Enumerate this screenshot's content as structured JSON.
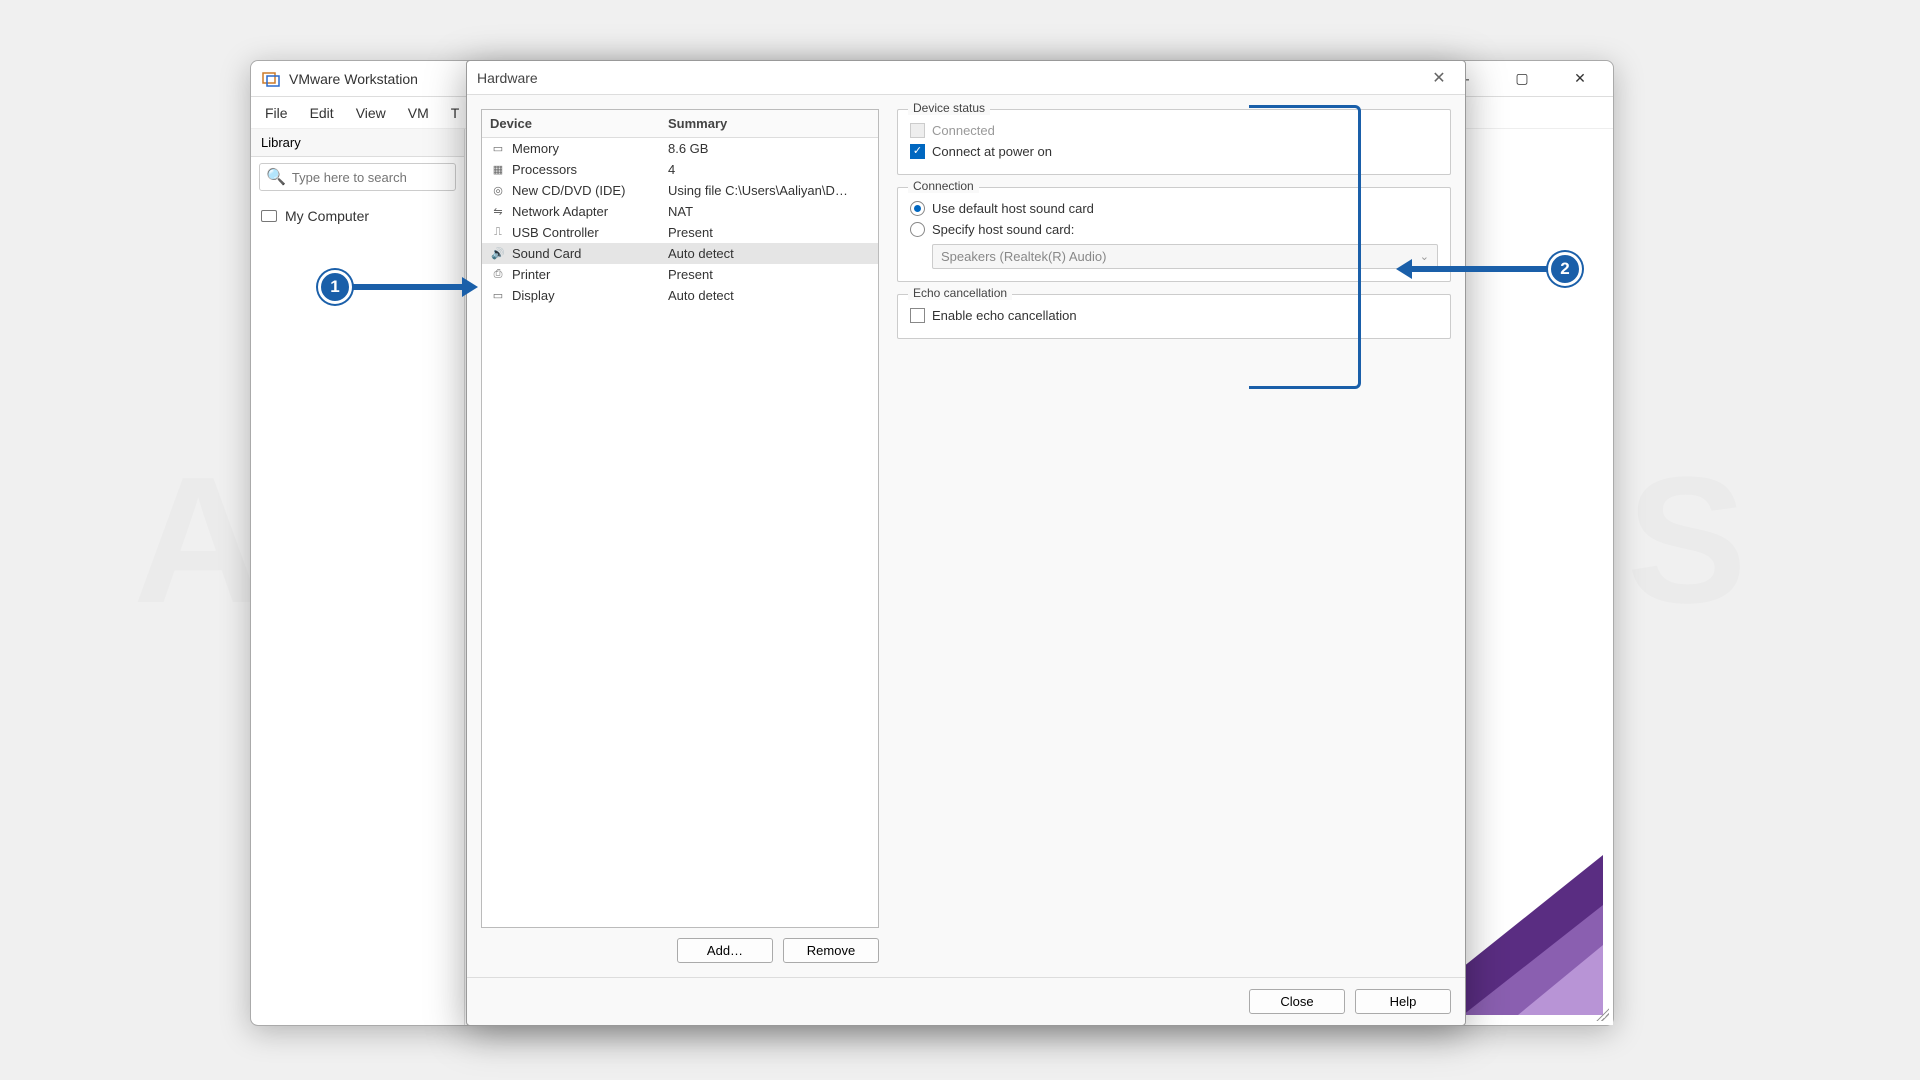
{
  "main_window": {
    "title": "VMware Workstation",
    "menu": [
      "File",
      "Edit",
      "View",
      "VM",
      "T"
    ],
    "sidebar": {
      "header": "Library",
      "search_placeholder": "Type here to search",
      "tree_item": "My Computer"
    }
  },
  "hw_dialog": {
    "title": "Hardware",
    "device_header": {
      "c1": "Device",
      "c2": "Summary"
    },
    "devices": [
      {
        "icon": "memory-icon",
        "name": "Memory",
        "summary": "8.6 GB",
        "ico": "▭"
      },
      {
        "icon": "cpu-icon",
        "name": "Processors",
        "summary": "4",
        "ico": "▦"
      },
      {
        "icon": "disc-icon",
        "name": "New CD/DVD (IDE)",
        "summary": "Using file C:\\Users\\Aaliyan\\D…",
        "ico": "◎"
      },
      {
        "icon": "network-icon",
        "name": "Network Adapter",
        "summary": "NAT",
        "ico": "⇋"
      },
      {
        "icon": "usb-icon",
        "name": "USB Controller",
        "summary": "Present",
        "ico": "⎍"
      },
      {
        "icon": "sound-icon",
        "name": "Sound Card",
        "summary": "Auto detect",
        "ico": "🔊",
        "selected": true
      },
      {
        "icon": "printer-icon",
        "name": "Printer",
        "summary": "Present",
        "ico": "⎙"
      },
      {
        "icon": "display-icon",
        "name": "Display",
        "summary": "Auto detect",
        "ico": "▭"
      }
    ],
    "buttons": {
      "add": "Add…",
      "remove": "Remove"
    },
    "device_status": {
      "legend": "Device status",
      "connected": "Connected",
      "connect_power": "Connect at power on"
    },
    "connection": {
      "legend": "Connection",
      "use_default": "Use default host sound card",
      "specify": "Specify host sound card:",
      "device_option": "Speakers (Realtek(R) Audio)"
    },
    "echo": {
      "legend": "Echo cancellation",
      "enable": "Enable echo cancellation"
    },
    "footer": {
      "close": "Close",
      "help": "Help"
    }
  },
  "callouts": {
    "one": "1",
    "two": "2"
  }
}
